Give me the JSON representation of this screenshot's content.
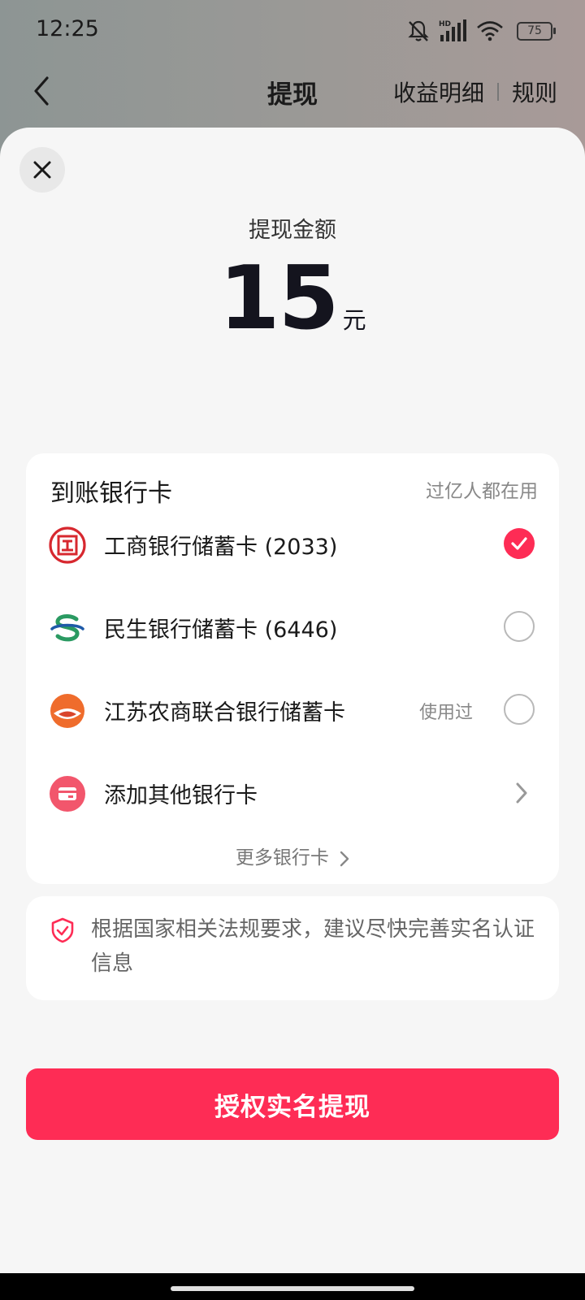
{
  "status_bar": {
    "time": "12:25",
    "battery": "75"
  },
  "header": {
    "title": "提现",
    "links": [
      "收益明细",
      "规则"
    ]
  },
  "amount": {
    "label": "提现金额",
    "value": "15",
    "unit": "元"
  },
  "bank_section": {
    "title": "到账银行卡",
    "hint": "过亿人都在用",
    "options": [
      {
        "name": "工商银行储蓄卡 (2033)",
        "icon": "icbc-logo-icon",
        "selected": true,
        "tag": ""
      },
      {
        "name": "民生银行储蓄卡 (6446)",
        "icon": "cmbc-logo-icon",
        "selected": false,
        "tag": ""
      },
      {
        "name": "江苏农商联合银行储蓄卡",
        "icon": "jsnsyh-logo-icon",
        "selected": false,
        "tag": "使用过"
      }
    ],
    "add_card": {
      "label": "添加其他银行卡",
      "icon": "card-icon"
    },
    "more_label": "更多银行卡"
  },
  "notice": {
    "text": "根据国家相关法规要求，建议尽快完善实名认证信息",
    "icon": "shield-check-icon"
  },
  "submit": {
    "label": "授权实名提现"
  },
  "colors": {
    "accent": "#fe2c55",
    "icbc_red": "#d7282f",
    "cmbc_green": "#2a9a62",
    "cmbc_blue": "#1e5aa8",
    "jsn_orange": "#ef6c2c"
  }
}
